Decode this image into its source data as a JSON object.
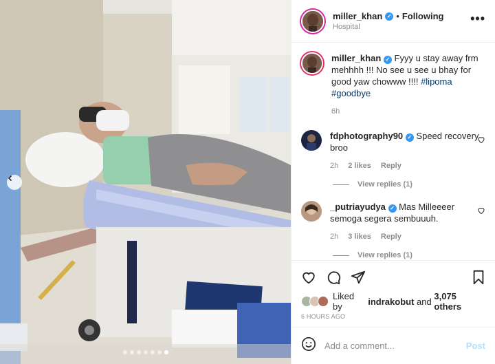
{
  "header": {
    "username": "miller_khan",
    "separator": "•",
    "follow_status": "Following",
    "location": "Hospital",
    "more_icon": "more-horizontal-icon"
  },
  "caption": {
    "username": "miller_khan",
    "text": "Fyyy u stay away frm mehhhh !!! No see u see u bhay for good yaw chowww !!!! ",
    "hashtags": "#lipoma #goodbye",
    "time": "6h"
  },
  "comments": [
    {
      "username": "fdphotography90",
      "text": "Speed recovery broo",
      "time": "2h",
      "likes": "2 likes",
      "reply_label": "Reply",
      "view_replies": "View replies (1)"
    },
    {
      "username": "_putriayudya",
      "text": "Mas Milleeeer semoga segera sembuuuh.",
      "time": "2h",
      "likes": "3 likes",
      "reply_label": "Reply",
      "view_replies": "View replies (1)"
    }
  ],
  "likes": {
    "prefix": "Liked by ",
    "user": "indrakobut",
    "middle": " and ",
    "count": "3,075 others"
  },
  "timestamp": "6 HOURS AGO",
  "add_comment": {
    "placeholder": "Add a comment...",
    "post_label": "Post"
  },
  "carousel": {
    "total": 7,
    "active_index": 6
  },
  "colors": {
    "verified": "#3897f0",
    "hashtag": "#00376b",
    "post_disabled": "#b2dffc",
    "meta": "#8e8e8e"
  }
}
